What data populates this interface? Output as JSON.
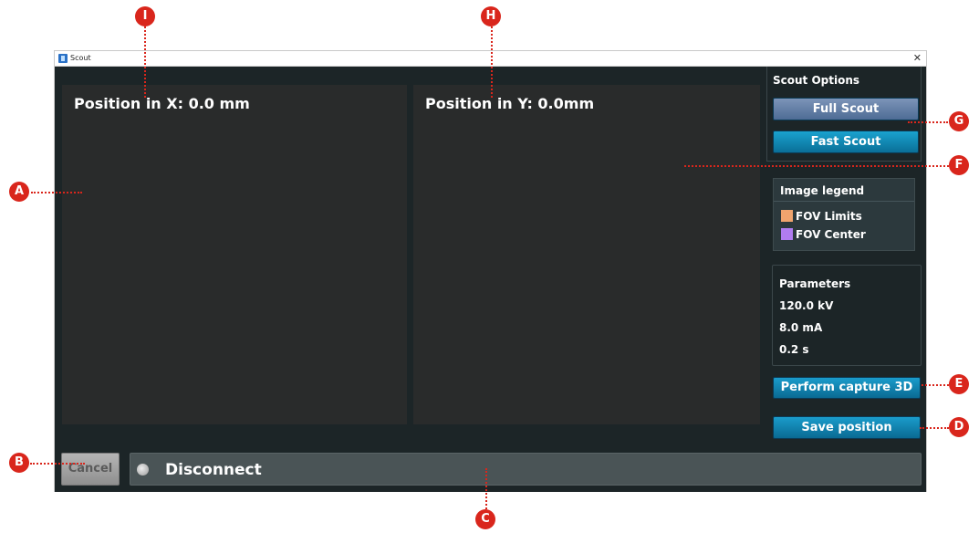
{
  "window": {
    "title": "Scout"
  },
  "panels": {
    "x_label": "Position in X:  0.0 mm",
    "y_label": "Position in Y:  0.0mm"
  },
  "scout_options": {
    "title": "Scout Options",
    "full_scout": "Full Scout",
    "fast_scout": "Fast Scout"
  },
  "legend": {
    "title": "Image legend",
    "items": [
      {
        "label": "FOV Limits",
        "color": "#f0a46e"
      },
      {
        "label": "FOV Center",
        "color": "#b07cf0"
      }
    ]
  },
  "parameters": {
    "title": "Parameters",
    "kv": "120.0 kV",
    "ma": "8.0 mA",
    "time": "0.2 s"
  },
  "buttons": {
    "capture": "Perform capture 3D",
    "save": "Save position",
    "cancel": "Cancel"
  },
  "status": {
    "text": "Disconnect"
  },
  "callouts": {
    "A": "A",
    "B": "B",
    "C": "C",
    "D": "D",
    "E": "E",
    "F": "F",
    "G": "G",
    "H": "H",
    "I": "I"
  },
  "colors": {
    "callout": "#d9261c",
    "accent_button": "#0a84b5"
  }
}
